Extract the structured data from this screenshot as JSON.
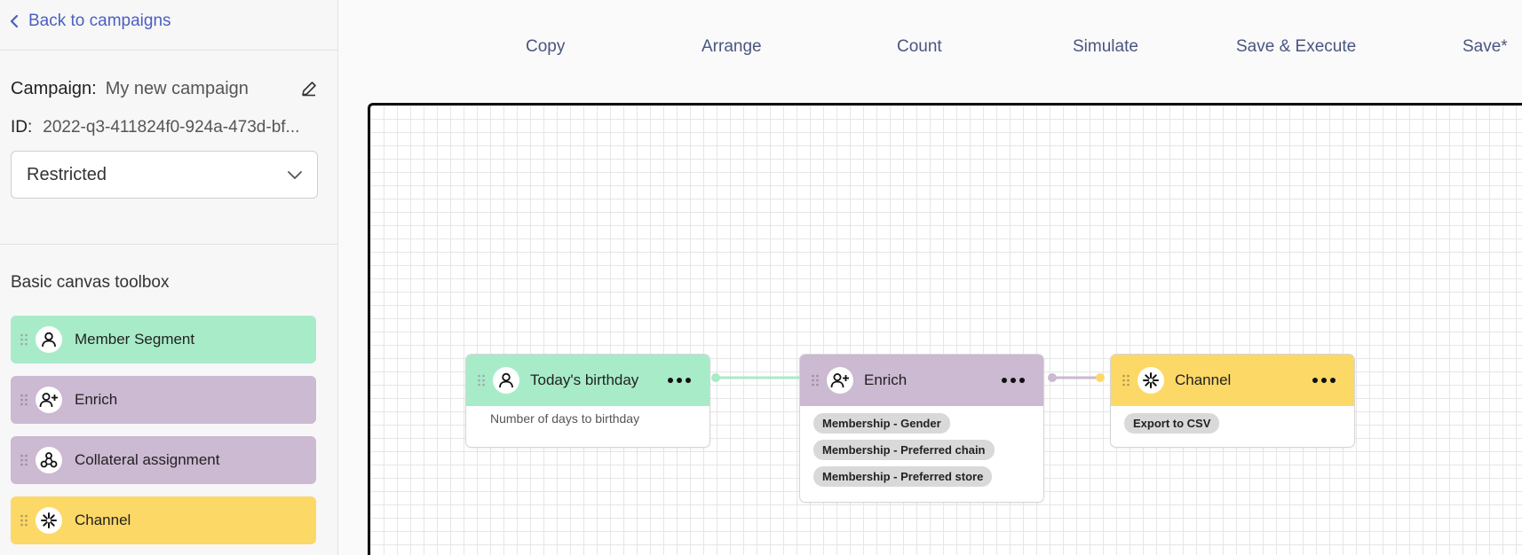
{
  "sidebar": {
    "back_label": "Back to campaigns",
    "campaign_label": "Campaign:",
    "campaign_name": "My new campaign",
    "id_label": "ID:",
    "id_value": "2022-q3-411824f0-924a-473d-bf...",
    "access_select": {
      "selected": "Restricted"
    },
    "toolbox_title": "Basic canvas toolbox",
    "tools": [
      {
        "label": "Member Segment",
        "icon": "person-icon",
        "color": "#a8ebc9"
      },
      {
        "label": "Enrich",
        "icon": "person-add-icon",
        "color": "#ccb9d2"
      },
      {
        "label": "Collateral assignment",
        "icon": "share-nodes-icon",
        "color": "#ccb9d2"
      },
      {
        "label": "Channel",
        "icon": "channel-burst-icon",
        "color": "#fcd866"
      }
    ]
  },
  "toolbar": {
    "copy": "Copy",
    "arrange": "Arrange",
    "count": "Count",
    "simulate": "Simulate",
    "save_execute": "Save & Execute",
    "save": "Save*"
  },
  "canvas": {
    "nodes": [
      {
        "title": "Today's birthday",
        "icon": "person-icon",
        "color": "#a8ebc9",
        "description": "Number of days to birthday"
      },
      {
        "title": "Enrich",
        "icon": "person-add-icon",
        "color": "#ccb9d2",
        "chips": [
          "Membership - Gender",
          "Membership - Preferred chain",
          "Membership - Preferred store"
        ]
      },
      {
        "title": "Channel",
        "icon": "channel-burst-icon",
        "color": "#fcd866",
        "chips": [
          "Export to CSV"
        ]
      }
    ],
    "connector_colors": [
      "#a8ebc9",
      "#ccb9d2"
    ]
  }
}
